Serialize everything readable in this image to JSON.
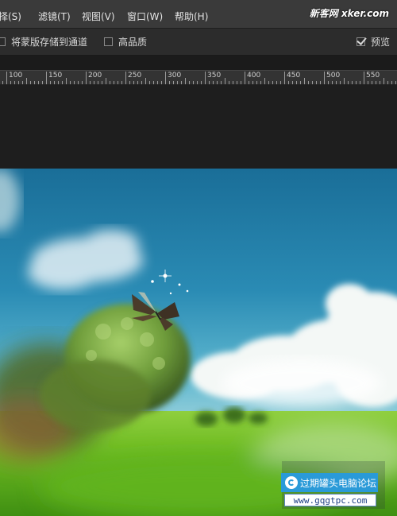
{
  "menu": {
    "items": [
      {
        "label": "选择(S)"
      },
      {
        "label": "滤镜(T)"
      },
      {
        "label": "视图(V)"
      },
      {
        "label": "窗口(W)"
      },
      {
        "label": "帮助(H)"
      }
    ],
    "watermark": "新客网 xker.com"
  },
  "options": {
    "save_mask_channel": {
      "label": "将蒙版存储到通道",
      "checked": false
    },
    "high_quality": {
      "label": "高品质",
      "checked": false
    },
    "preview": {
      "label": "预览",
      "checked": true
    }
  },
  "ruler": {
    "labels": [
      "100",
      "150",
      "200",
      "250",
      "300",
      "350",
      "400",
      "450",
      "500",
      "550"
    ]
  },
  "forum": {
    "name": "过期罐头电脑论坛",
    "url": "www.gqgtpc.com"
  }
}
